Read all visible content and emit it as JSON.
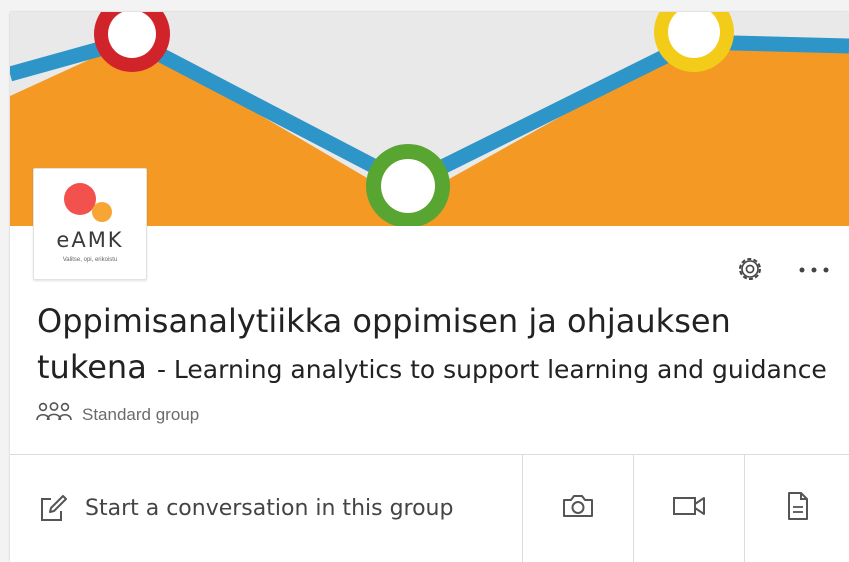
{
  "logo": {
    "name": "eAMK",
    "tagline": "Valitse, opi, erikoistu",
    "colors": {
      "primary": "#f2514d",
      "secondary": "#f7a534"
    }
  },
  "cover": {
    "colors": {
      "background": "#e9e9e9",
      "area": "#f49a24",
      "line": "#2e95c9",
      "marker_red": "#d1232a",
      "marker_green": "#59a532",
      "marker_yellow": "#f3cc1a"
    }
  },
  "toolbar": {
    "settings_icon": "gear-icon",
    "more_icon": "more-horizontal-icon",
    "more_label": "···"
  },
  "group": {
    "title_main": "Oppimisanalytiikka oppimisen ja ohjauksen tukena",
    "title_sub": "- Learning analytics to support learning and guidance",
    "type_label": "Standard group",
    "type_icon": "people-group-icon"
  },
  "composer": {
    "start_label": "Start a conversation in this group",
    "start_icon": "edit-pencil-icon",
    "actions": [
      {
        "icon": "camera-icon"
      },
      {
        "icon": "video-camera-icon"
      },
      {
        "icon": "document-icon"
      }
    ]
  }
}
